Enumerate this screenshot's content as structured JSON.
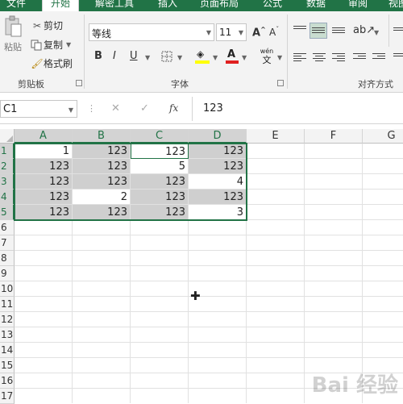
{
  "ribbon_tabs": [
    "文件",
    "开始",
    "解密工具",
    "插入",
    "页面布局",
    "公式",
    "数据",
    "审阅",
    "视图"
  ],
  "active_tab": "开始",
  "clipboard": {
    "paste": "粘贴",
    "cut": "剪切",
    "copy": "复制",
    "format_painter": "格式刷",
    "group": "剪贴板"
  },
  "font": {
    "name": "等线",
    "size": "11",
    "bold": "B",
    "italic": "I",
    "underline": "U",
    "phonetic_top": "wén",
    "phonetic_bottom": "文",
    "group": "字体"
  },
  "alignment": {
    "group": "对齐方式"
  },
  "formula_bar": {
    "name_box": "C1",
    "cancel": "✕",
    "confirm": "✓",
    "fx": "fx",
    "value": "123"
  },
  "columns": [
    "A",
    "B",
    "C",
    "D",
    "E",
    "F",
    "G"
  ],
  "rows": [
    "1",
    "2",
    "3",
    "4",
    "5",
    "6",
    "7",
    "8",
    "9",
    "10",
    "11",
    "12",
    "13",
    "14",
    "15",
    "16",
    "17"
  ],
  "cells": [
    [
      "1",
      "123",
      "123",
      "123"
    ],
    [
      "123",
      "123",
      "5",
      "123"
    ],
    [
      "123",
      "123",
      "123",
      "4"
    ],
    [
      "123",
      "2",
      "123",
      "123"
    ],
    [
      "123",
      "123",
      "123",
      "3"
    ]
  ],
  "watermark": "Bai 经验",
  "colors": {
    "accent": "#217346",
    "selected_fill": "#cfcfcf"
  }
}
